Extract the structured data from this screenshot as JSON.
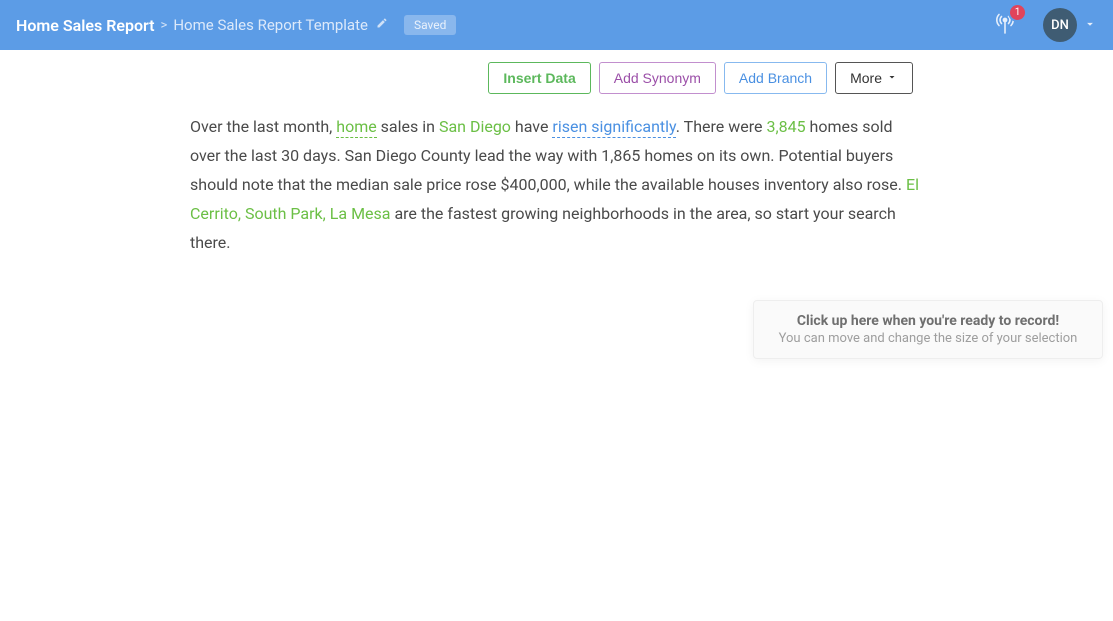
{
  "header": {
    "title": "Home Sales Report",
    "separator": ">",
    "subtitle": "Home Sales Report Template",
    "saved_label": "Saved",
    "notification_count": "1",
    "avatar_initials": "DN"
  },
  "toolbar": {
    "insert_data": "Insert Data",
    "add_synonym": "Add Synonym",
    "add_branch": "Add Branch",
    "more": "More"
  },
  "content": {
    "t1": "Over the last month, ",
    "home": "home",
    "t2": " sales in ",
    "san_diego": "San Diego",
    "t3": " have ",
    "risen": "risen significantly",
    "t4": ".  There were ",
    "count": "3,845",
    "t5": " homes sold over the last 30 days.  San Diego County lead the way with 1,865 homes on its own.  Potential buyers should note that the median sale price rose $400,000, while the available houses inventory also rose.  ",
    "hoods": "El Cerrito, South Park, La Mesa",
    "t6": " are the fastest growing neighborhoods in the area, so start your search there."
  },
  "hint": {
    "title": "Click up here when you're ready to record!",
    "sub": "You can move and change the size of your selection"
  }
}
